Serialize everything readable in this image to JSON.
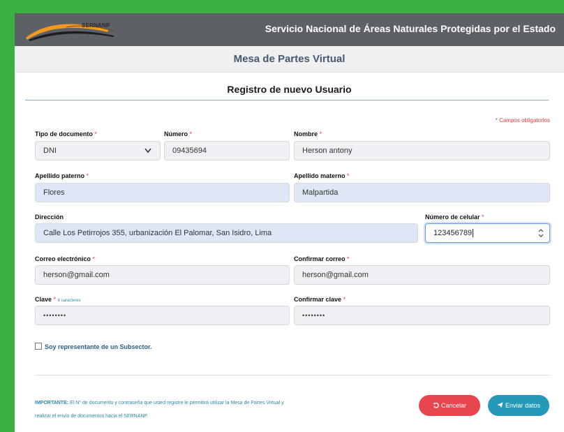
{
  "header": {
    "logo_text": "SERNANP",
    "org_title": "Servicio Nacional de Áreas Naturales Protegidas por el Estado",
    "app_title": "Mesa de Partes Virtual"
  },
  "form": {
    "title": "Registro de nuevo Usuario",
    "required_note": "* Campos obligatorios",
    "fields": {
      "doc_type": {
        "label": "Tipo de documento",
        "value": "DNI"
      },
      "number": {
        "label": "Número",
        "value": "09435694"
      },
      "name": {
        "label": "Nombre",
        "value": "Herson antony"
      },
      "last_name_1": {
        "label": "Apellido paterno",
        "value": "Flores"
      },
      "last_name_2": {
        "label": "Apellido materno",
        "value": "Malpartida"
      },
      "address": {
        "label": "Dirección",
        "value": "Calle Los Petirrojos 355, urbanización El Palomar, San Isidro, Lima"
      },
      "phone": {
        "label": "Número de celular",
        "value": "123456789"
      },
      "email": {
        "label": "Correo electrónico",
        "value": "herson@gmail.com"
      },
      "email_confirm": {
        "label": "Confirmar correo",
        "value": "herson@gmail.com"
      },
      "password": {
        "label": "Clave",
        "hint": "8 caracteres",
        "value": "••••••••"
      },
      "password_confirm": {
        "label": "Confirmar clave",
        "value": "••••••••"
      }
    },
    "star": "*",
    "checkbox_label": "Soy representante de un Subsector.",
    "important_label": "IMPORTANTE:",
    "important_text_1": " El N° de documento y contraseña que usted registre le permitirá utilizar la Mesa de Partes Virtual y",
    "important_text_2": "realizar el envío de documentos hacia el SERNANP.",
    "cancel_label": "Cancelar",
    "send_label": "Enviar datos"
  },
  "colors": {
    "header": "#5d6166",
    "cancel": "#e8464e",
    "send": "#2599b7",
    "required": "#e03a3a"
  }
}
